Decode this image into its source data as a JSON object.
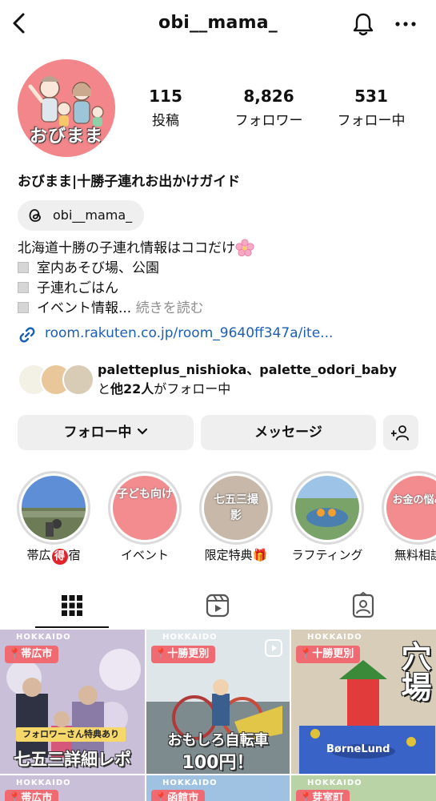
{
  "topbar": {
    "username": "obi__mama_",
    "back_icon": "chevron-left-icon",
    "bell_icon": "bell-icon",
    "more_icon": "ellipsis-icon"
  },
  "profile": {
    "avatar_text": "おびまま",
    "stats": [
      {
        "num": "115",
        "label": "投稿"
      },
      {
        "num": "8,826",
        "label": "フォロワー"
      },
      {
        "num": "531",
        "label": "フォロー中"
      }
    ],
    "display_name": "おびまま|十勝子連れお出かけガイド",
    "threads_handle": "obi__mama_",
    "bio": {
      "line1": "北海道十勝の子連れ情報はココだけ",
      "line2": "室内あそび場、公園",
      "line3": "子連れごはん",
      "line4": "イベント情報...",
      "more": "続きを読む"
    },
    "link": "room.rakuten.co.jp/room_9640ff347a/ite...",
    "followed_by": {
      "names": "paletteplus_nishioka、palette_odori_baby",
      "pre": "と",
      "others": "他22人",
      "post": "がフォロー中"
    }
  },
  "buttons": {
    "following": "フォロー中",
    "message": "メッセージ",
    "add_person_icon": "add-person-icon"
  },
  "highlights": [
    {
      "label": "帯広",
      "badge": "得",
      "label_tail": "宿"
    },
    {
      "label": "イベント",
      "cover": "子ども向け"
    },
    {
      "label": "限定特典🎁",
      "cover": "七五三撮影"
    },
    {
      "label": "ラフティング"
    },
    {
      "label": "無料相談",
      "cover": "お金の悩み"
    }
  ],
  "tabs": [
    "grid-icon",
    "reels-icon",
    "tagged-icon"
  ],
  "posts": [
    {
      "region": "HOKKAIDO",
      "pin": "帯広市",
      "banner": "フォロワーさん特典あり",
      "title": "七五三詳細レポ"
    },
    {
      "region": "HOKKAIDO",
      "pin": "十勝更別",
      "title": "おもしろ自転車",
      "sub": "100円！"
    },
    {
      "region": "HOKKAIDO",
      "pin": "十勝更別",
      "title": "穴場",
      "sign": "BørneLund"
    },
    {
      "region": "HOKKAIDO",
      "pin": "帯広市"
    },
    {
      "region": "HOKKAIDO",
      "pin": "函館市"
    },
    {
      "region": "HOKKAIDO",
      "pin": "芽室町"
    }
  ]
}
